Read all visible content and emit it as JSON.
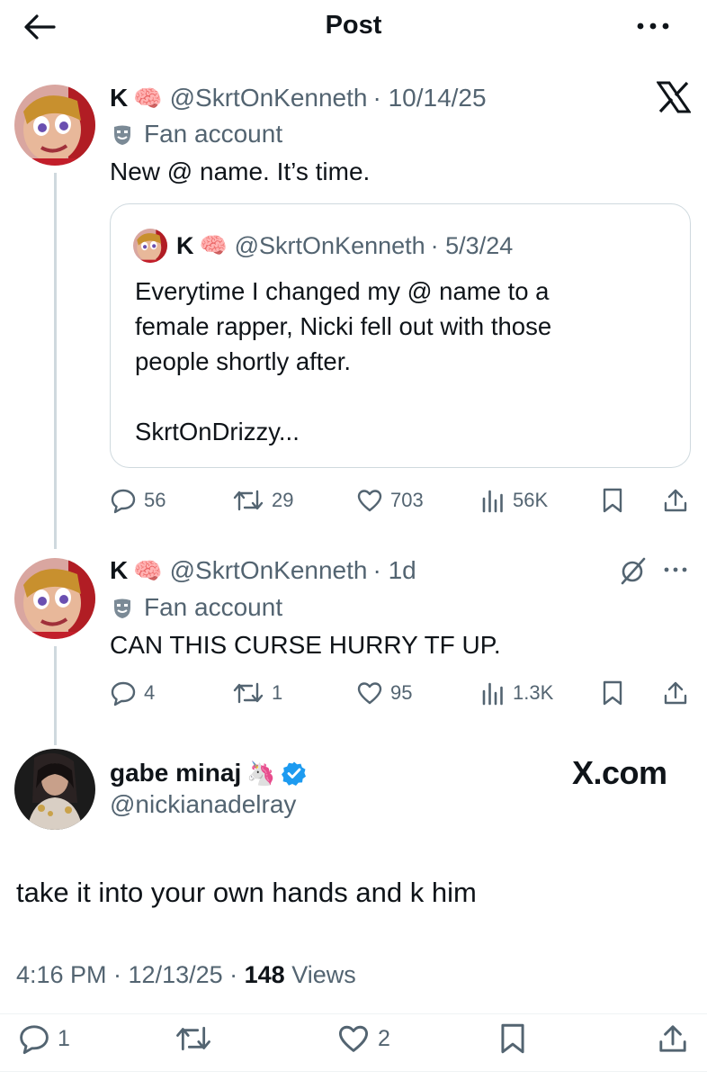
{
  "header": {
    "title": "Post"
  },
  "tweet1": {
    "name": "K",
    "brain": "🧠",
    "handle": "@SkrtOnKenneth",
    "date": "· 10/14/25",
    "badge": "Fan account",
    "text": "New @ name. It’s time.",
    "quote": {
      "name": "K",
      "brain": "🧠",
      "handle": "@SkrtOnKenneth",
      "date": "· 5/3/24",
      "text": "Everytime I changed my @ name to a\nfemale rapper, Nicki fell out with those\npeople shortly after.\n\nSkrtOnDrizzy..."
    },
    "stats": {
      "replies": "56",
      "reposts": "29",
      "likes": "703",
      "views": "56K"
    }
  },
  "tweet2": {
    "name": "K",
    "brain": "🧠",
    "handle": "@SkrtOnKenneth",
    "date": "· 1d",
    "badge": "Fan account",
    "text": "CAN THIS CURSE HURRY TF UP.",
    "stats": {
      "replies": "4",
      "reposts": "1",
      "likes": "95",
      "views": "1.3K"
    }
  },
  "main": {
    "name": "gabe minaj",
    "emoji": "🦄",
    "handle": "@nickianadelray",
    "watermark": "X.com",
    "text": "take it into your own hands and k him",
    "time": "4:16 PM · 12/13/25 · ",
    "views_count": "148",
    "views_label": " Views",
    "stats": {
      "replies": "1",
      "likes": "2"
    }
  },
  "colors": {
    "verified": "#1d9bf0",
    "muted": "#536471",
    "border": "#cfd9de"
  }
}
